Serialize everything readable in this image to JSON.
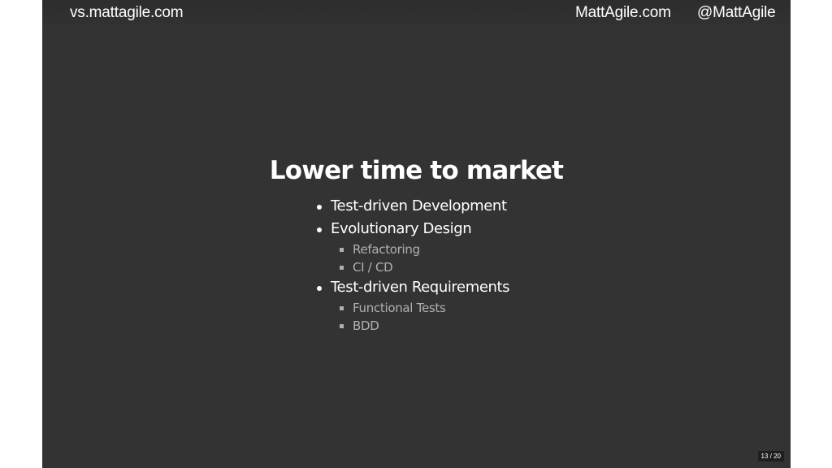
{
  "header": {
    "left_text": "vs.mattagile.com",
    "center_text": "MattAgile.com",
    "right_text": "@MattAgile"
  },
  "slide": {
    "title": "Lower time to market",
    "bullets": [
      {
        "label": "Test-driven Development",
        "sub": []
      },
      {
        "label": "Evolutionary Design",
        "sub": [
          "Refactoring",
          "CI / CD"
        ]
      },
      {
        "label": "Test-driven Requirements",
        "sub": [
          "Functional Tests",
          "BDD"
        ]
      }
    ]
  },
  "pager": {
    "label": "13 / 20"
  },
  "colors": {
    "slide_bg": "#333333",
    "text_primary": "#ffffff",
    "text_secondary": "#b0b0b0"
  }
}
